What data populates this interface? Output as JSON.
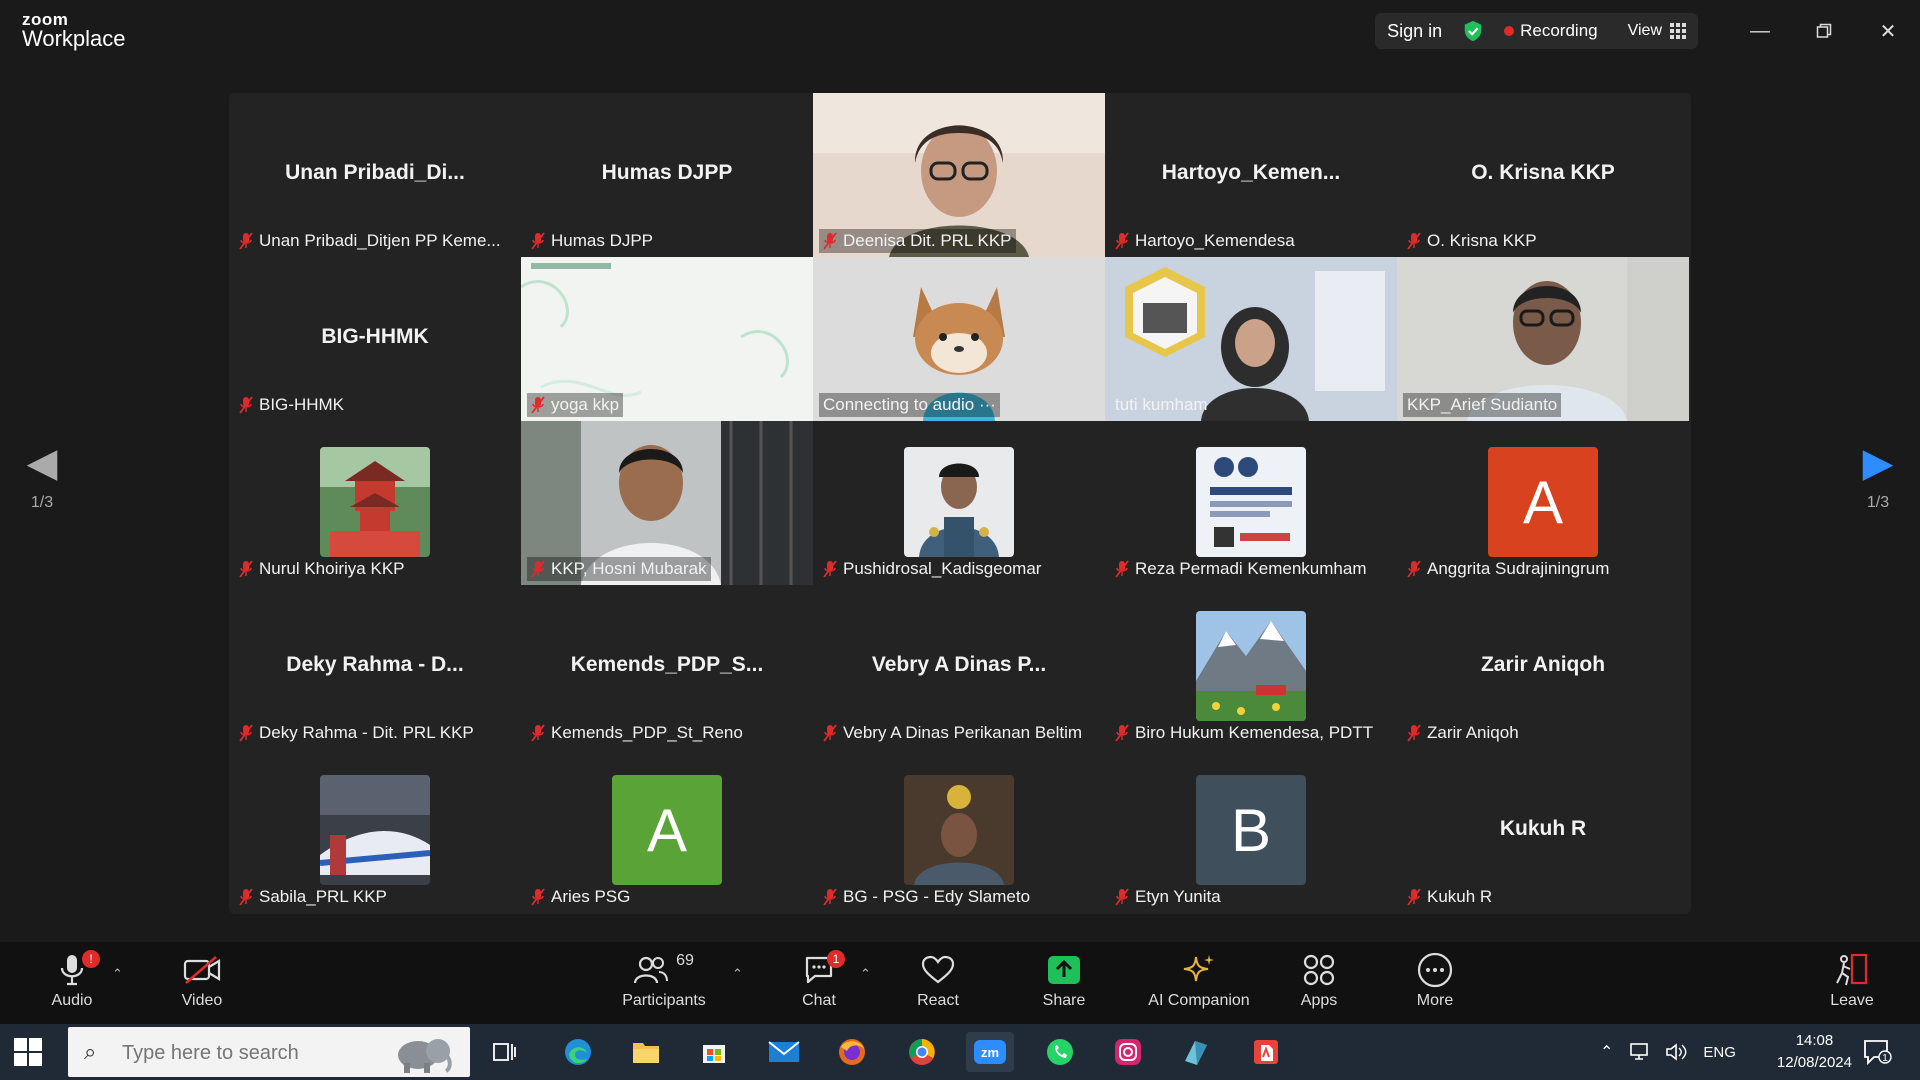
{
  "app": {
    "brand_top": "zoom",
    "brand_bottom": "Workplace"
  },
  "titlebar": {
    "sign_in": "Sign in",
    "recording": "Recording",
    "view": "View"
  },
  "colors": {
    "active_speaker": "#22d46a",
    "recording": "#e02b2b",
    "share": "#1fbf5a",
    "accent": "#2d8cff"
  },
  "pagination": {
    "left": "1/3",
    "right": "1/3"
  },
  "tiles": [
    {
      "big": "Unan  Pribadi_Di...",
      "label": "Unan Pribadi_Ditjen PP Keme..."
    },
    {
      "big": "Humas DJPP",
      "label": "Humas DJPP"
    },
    {
      "big": "",
      "label": "Deenisa Dit. PRL KKP"
    },
    {
      "big": "Hartoyo_Kemen...",
      "label": "Hartoyo_Kemendesa"
    },
    {
      "big": "O. Krisna KKP",
      "label": "O. Krisna KKP"
    },
    {
      "big": "BIG-HHMK",
      "label": "BIG-HHMK"
    },
    {
      "big": "",
      "label": "yoga kkp"
    },
    {
      "big": "",
      "label": "Connecting to audio ···"
    },
    {
      "big": "",
      "label": "tuti kumham"
    },
    {
      "big": "",
      "label": "KKP_Arief Sudianto"
    },
    {
      "big": "",
      "label": "Nurul Khoiriya KKP"
    },
    {
      "big": "",
      "label": "KKP, Hosni Mubarak"
    },
    {
      "big": "",
      "label": "Pushidrosal_Kadisgeomar"
    },
    {
      "big": "",
      "label": "Reza Permadi Kemenkumham"
    },
    {
      "big": "",
      "label": "Anggrita Sudrajiningrum",
      "letter": "A"
    },
    {
      "big": "Deky Rahma - D...",
      "label": "Deky Rahma - Dit. PRL KKP"
    },
    {
      "big": "Kemends_PDP_S...",
      "label": "Kemends_PDP_St_Reno"
    },
    {
      "big": "Vebry A Dinas P...",
      "label": "Vebry A Dinas Perikanan Beltim"
    },
    {
      "big": "",
      "label": "Biro Hukum Kemendesa, PDTT"
    },
    {
      "big": "Zarir Aniqoh",
      "label": "Zarir Aniqoh"
    },
    {
      "big": "",
      "label": "Sabila_PRL KKP"
    },
    {
      "big": "",
      "label": "Aries PSG",
      "letter": "A"
    },
    {
      "big": "",
      "label": "BG - PSG - Edy Slameto"
    },
    {
      "big": "",
      "label": "Etyn Yunita",
      "letter": "B"
    },
    {
      "big": "Kukuh R",
      "label": "Kukuh R"
    }
  ],
  "toolbar": {
    "audio": "Audio",
    "audio_badge": "!",
    "video": "Video",
    "participants": "Participants",
    "participants_count": "69",
    "chat": "Chat",
    "chat_badge": "1",
    "react": "React",
    "share": "Share",
    "ai": "AI Companion",
    "apps": "Apps",
    "more": "More",
    "leave": "Leave"
  },
  "taskbar": {
    "search_placeholder": "Type here to search",
    "lang": "ENG",
    "time": "14:08",
    "date": "12/08/2024"
  }
}
